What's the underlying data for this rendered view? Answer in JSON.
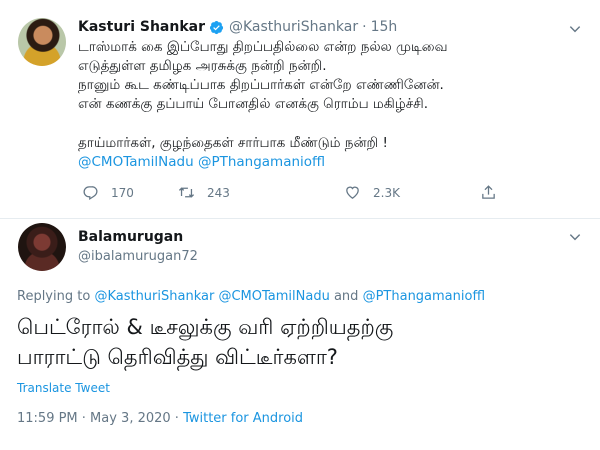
{
  "tweet": {
    "author_name": "Kasturi Shankar",
    "author_handle": "@KasthuriShankar",
    "separator": "·",
    "time_ago": "15h",
    "lines": [
      "டாஸ்மாக் கை இப்போது திறப்பதில்லை என்ற நல்ல முடிவை",
      "எடுத்துள்ள தமிழக அரசுக்கு நன்றி நன்றி.",
      "நானும் கூட கண்டிப்பாக திறப்பார்கள் என்றே எண்ணினேன்.",
      "என் கணக்கு தப்பாய் போனதில் எனக்கு ரொம்ப மகிழ்ச்சி.",
      "தாய்மார்கள், குழந்தைகள் சார்பாக மீண்டும் நன்றி !"
    ],
    "mentions": [
      "@CMOTamilNadu",
      "@PThangamanioffl"
    ],
    "replies": "170",
    "retweets": "243",
    "likes": "2.3K"
  },
  "reply": {
    "author_name": "Balamurugan",
    "author_handle": "@ibalamurugan72",
    "replying_prefix": "Replying to",
    "replying_mentions": [
      "@KasthuriShankar",
      "@CMOTamilNadu",
      "@PThangamanioffl"
    ],
    "replying_and": "and",
    "text_lines": [
      "பெட்ரோல் & டீசலுக்கு வரி ஏற்றியதற்கு",
      "பாராட்டு தெரிவித்து விட்டீர்களா?"
    ],
    "translate_label": "Translate Tweet",
    "timestamp": "11:59 PM · May 3, 2020 · ",
    "source": "Twitter for Android"
  },
  "icons": {
    "verified": "verified-badge-icon",
    "chevron": "chevron-down-icon",
    "reply": "reply-icon",
    "retweet": "retweet-icon",
    "like": "heart-icon",
    "share": "share-icon"
  },
  "colors": {
    "accent": "#1b95e0",
    "muted": "#657786",
    "text": "#14171a"
  }
}
